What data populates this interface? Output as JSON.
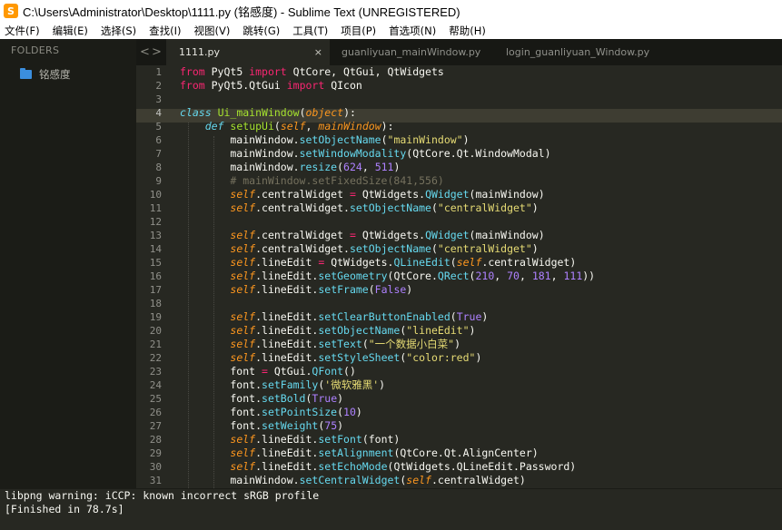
{
  "window": {
    "title": "C:\\Users\\Administrator\\Desktop\\1111.py (铭感度) - Sublime Text (UNREGISTERED)",
    "icon": "sublime-text-icon",
    "icon_color": "#ff9800"
  },
  "menu": [
    "文件(F)",
    "编辑(E)",
    "选择(S)",
    "查找(I)",
    "视图(V)",
    "跳转(G)",
    "工具(T)",
    "项目(P)",
    "首选项(N)",
    "帮助(H)"
  ],
  "sidebar": {
    "header": "FOLDERS",
    "folder": "铭感度",
    "folder_icon": "folder-icon",
    "folder_color": "#3b8ede"
  },
  "tabs": {
    "nav_left": "<",
    "nav_right": ">",
    "items": [
      {
        "label": "1111.py",
        "active": true,
        "close": "×"
      },
      {
        "label": "guanliyuan_mainWindow.py",
        "active": false
      },
      {
        "label": "login_guanliyuan_Window.py",
        "active": false
      }
    ]
  },
  "editor": {
    "current_line": 4,
    "theme_colors": {
      "background": "#272822",
      "keyword": "#f92672",
      "function": "#a6e22e",
      "string": "#e6db74",
      "number": "#ae81ff",
      "comment": "#75715e"
    },
    "lines": [
      {
        "n": "1",
        "t": "from PyQt5 import QtCore, QtGui, QtWidgets"
      },
      {
        "n": "2",
        "t": "from PyQt5.QtGui import QIcon"
      },
      {
        "n": "3",
        "t": ""
      },
      {
        "n": "4",
        "t": "class Ui_mainWindow(object):"
      },
      {
        "n": "5",
        "t": "    def setupUi(self, mainWindow):"
      },
      {
        "n": "6",
        "t": "        mainWindow.setObjectName(\"mainWindow\")"
      },
      {
        "n": "7",
        "t": "        mainWindow.setWindowModality(QtCore.Qt.WindowModal)"
      },
      {
        "n": "8",
        "t": "        mainWindow.resize(624, 511)"
      },
      {
        "n": "9",
        "t": "        # mainWindow.setFixedSize(841,556)"
      },
      {
        "n": "10",
        "t": "        self.centralWidget = QtWidgets.QWidget(mainWindow)"
      },
      {
        "n": "11",
        "t": "        self.centralWidget.setObjectName(\"centralWidget\")"
      },
      {
        "n": "12",
        "t": ""
      },
      {
        "n": "13",
        "t": "        self.centralWidget = QtWidgets.QWidget(mainWindow)"
      },
      {
        "n": "14",
        "t": "        self.centralWidget.setObjectName(\"centralWidget\")"
      },
      {
        "n": "15",
        "t": "        self.lineEdit = QtWidgets.QLineEdit(self.centralWidget)"
      },
      {
        "n": "16",
        "t": "        self.lineEdit.setGeometry(QtCore.QRect(210, 70, 181, 111))"
      },
      {
        "n": "17",
        "t": "        self.lineEdit.setFrame(False)"
      },
      {
        "n": "18",
        "t": ""
      },
      {
        "n": "19",
        "t": "        self.lineEdit.setClearButtonEnabled(True)"
      },
      {
        "n": "20",
        "t": "        self.lineEdit.setObjectName(\"lineEdit\")"
      },
      {
        "n": "21",
        "t": "        self.lineEdit.setText(\"一个数据小白菜\")"
      },
      {
        "n": "22",
        "t": "        self.lineEdit.setStyleSheet(\"color:red\")"
      },
      {
        "n": "23",
        "t": "        font = QtGui.QFont()"
      },
      {
        "n": "24",
        "t": "        font.setFamily('微软雅黑')"
      },
      {
        "n": "25",
        "t": "        font.setBold(True)"
      },
      {
        "n": "26",
        "t": "        font.setPointSize(10)"
      },
      {
        "n": "27",
        "t": "        font.setWeight(75)"
      },
      {
        "n": "28",
        "t": "        self.lineEdit.setFont(font)"
      },
      {
        "n": "29",
        "t": "        self.lineEdit.setAlignment(QtCore.Qt.AlignCenter)"
      },
      {
        "n": "30",
        "t": "        self.lineEdit.setEchoMode(QtWidgets.QLineEdit.Password)"
      },
      {
        "n": "31",
        "t": "        mainWindow.setCentralWidget(self.centralWidget)"
      }
    ]
  },
  "console": {
    "lines": [
      "libpng warning: iCCP: known incorrect sRGB profile",
      "[Finished in 78.7s]"
    ]
  }
}
